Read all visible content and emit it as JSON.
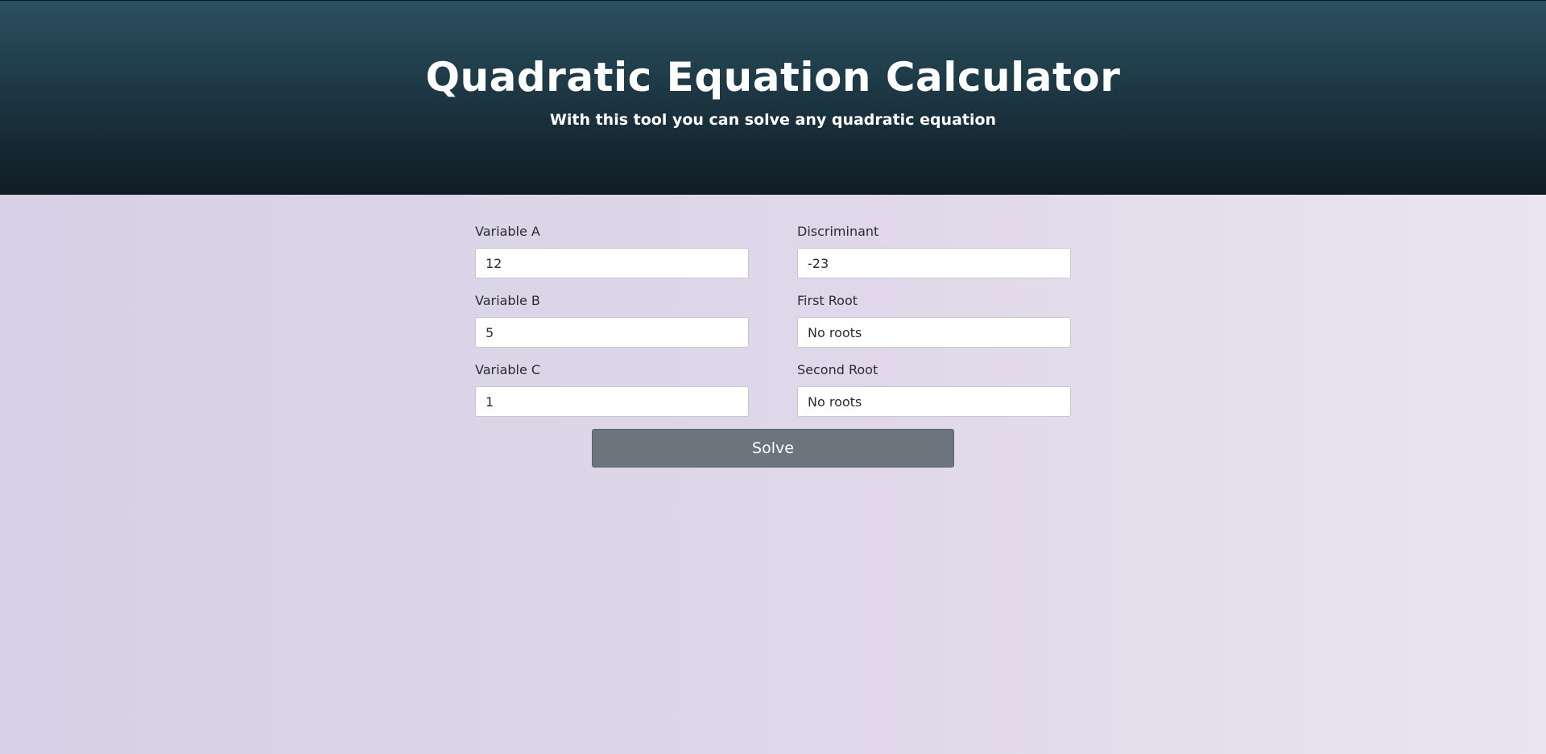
{
  "header": {
    "title": "Quadratic Equation Calculator",
    "subtitle": "With this tool you can solve any quadratic equation"
  },
  "form": {
    "variable_a": {
      "label": "Variable A",
      "value": "12"
    },
    "variable_b": {
      "label": "Variable B",
      "value": "5"
    },
    "variable_c": {
      "label": "Variable C",
      "value": "1"
    },
    "discriminant": {
      "label": "Discriminant",
      "value": "-23"
    },
    "first_root": {
      "label": "First Root",
      "value": "No roots"
    },
    "second_root": {
      "label": "Second Root",
      "value": "No roots"
    },
    "solve_label": "Solve"
  },
  "colors": {
    "header_top": "#2b5060",
    "header_bottom": "#101c24",
    "background": "#ddd6e9",
    "button": "#6c757d"
  }
}
